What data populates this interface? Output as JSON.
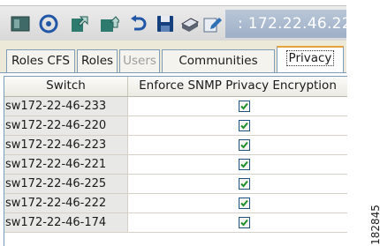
{
  "toolbar": {
    "icons": [
      "panel-icon",
      "refresh-icon",
      "export-icon",
      "import-icon",
      "undo-icon",
      "save-icon",
      "print-icon",
      "edit-icon"
    ],
    "address": ": 172.22.46.22"
  },
  "tabs": [
    {
      "label": "Roles CFS",
      "state": "normal"
    },
    {
      "label": "Roles",
      "state": "normal"
    },
    {
      "label": "Users",
      "state": "disabled"
    },
    {
      "label": "Communities",
      "state": "normal"
    },
    {
      "label": "Privacy",
      "state": "active"
    }
  ],
  "table": {
    "columns": [
      "Switch",
      "Enforce SNMP Privacy Encryption"
    ],
    "rows": [
      {
        "switch": "sw172-22-46-233",
        "enforce": true
      },
      {
        "switch": "sw172-22-46-220",
        "enforce": true
      },
      {
        "switch": "sw172-22-46-223",
        "enforce": true
      },
      {
        "switch": "sw172-22-46-221",
        "enforce": true
      },
      {
        "switch": "sw172-22-46-225",
        "enforce": true
      },
      {
        "switch": "sw172-22-46-222",
        "enforce": true
      },
      {
        "switch": "sw172-22-46-174",
        "enforce": true
      }
    ]
  },
  "figure_id": "182845",
  "colors": {
    "accent": "#e6a23a",
    "border": "#7f9db9",
    "check": "#1f8f2a"
  }
}
